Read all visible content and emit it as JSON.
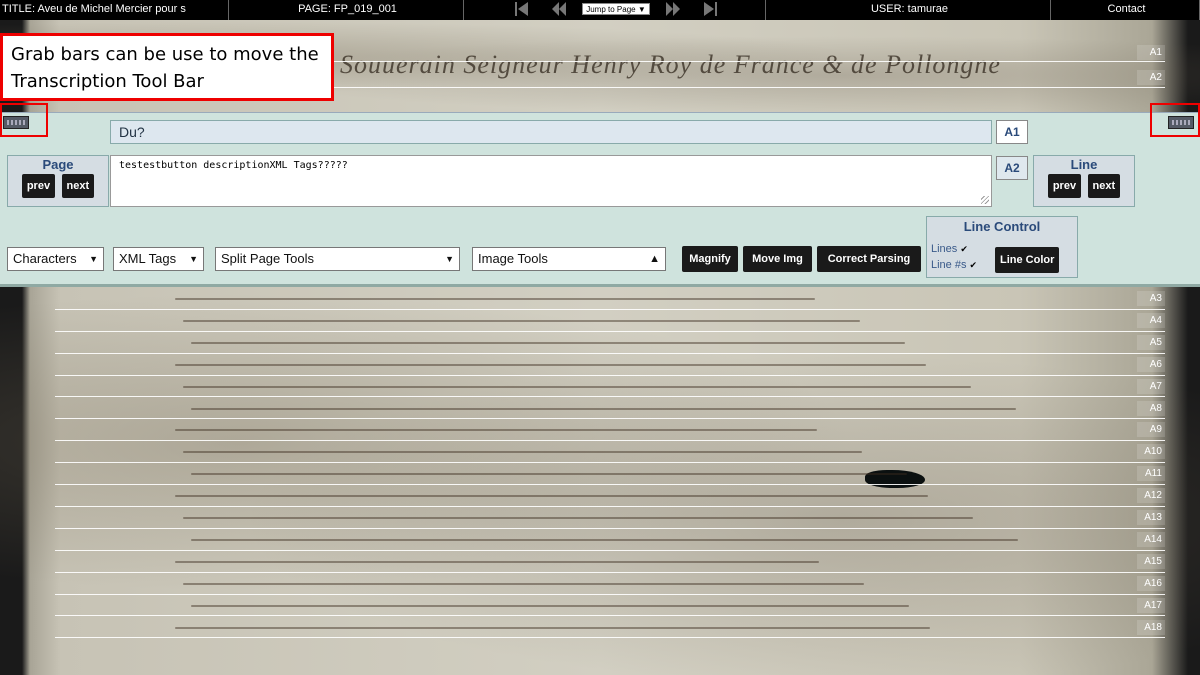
{
  "topbar": {
    "title": "TITLE: Aveu de Michel Mercier pour s",
    "page": "PAGE:  FP_019_001",
    "jump_label": "Jump to Page",
    "user": "USER:  tamurae",
    "contact": "Contact"
  },
  "toolbar": {
    "current_line_text": "Du?",
    "current_line_label": "A1",
    "next_line_label": "A2",
    "transcription_text": "testestbutton descriptionXML Tags?????",
    "page_nav": {
      "title": "Page",
      "prev": "prev",
      "next": "next"
    },
    "line_nav": {
      "title": "Line",
      "prev": "prev",
      "next": "next"
    },
    "dropdowns": {
      "characters": "Characters",
      "xml_tags": "XML Tags",
      "split_page": "Split Page Tools",
      "image_tools": "Image Tools"
    },
    "buttons": {
      "magnify": "Magnify",
      "move_img": "Move Img",
      "correct_parsing": "Correct Parsing"
    },
    "line_control": {
      "title": "Line Control",
      "lines_label": "Lines",
      "line_numbers_label": "Line #s",
      "line_color": "Line Color"
    }
  },
  "callout": {
    "line1": "Grab bars can be use to move the",
    "line2": "Transcription Tool Bar"
  },
  "manuscript": {
    "heading": "Souuerain Seigneur Henry Roy de France & de Pollongne",
    "top_lines": [
      "A1",
      "A2"
    ],
    "bottom_lines": [
      "A3",
      "A4",
      "A5",
      "A6",
      "A7",
      "A8",
      "A9",
      "A10",
      "A11",
      "A12",
      "A13",
      "A14",
      "A15",
      "A16",
      "A17",
      "A18"
    ]
  }
}
